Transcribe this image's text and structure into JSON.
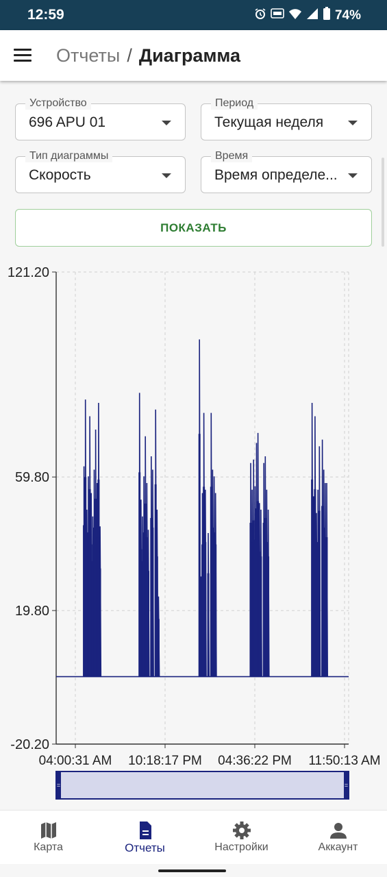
{
  "status_bar": {
    "time": "12:59",
    "battery": "74%",
    "icons": [
      "alarm-icon",
      "auto-icon",
      "wifi-icon",
      "signal-icon",
      "battery-icon"
    ]
  },
  "appbar": {
    "crumb_parent": "Отчеты",
    "crumb_separator": "/",
    "crumb_current": "Диаграмма"
  },
  "form": {
    "device_label": "Устройство",
    "device_value": "696 APU 01",
    "period_label": "Период",
    "period_value": "Текущая неделя",
    "chart_type_label": "Тип диаграммы",
    "chart_type_value": "Скорость",
    "time_label": "Время",
    "time_value": "Время определе...",
    "show_button": "ПОКАЗАТЬ"
  },
  "chart_data": {
    "type": "line",
    "title": "",
    "xlabel": "",
    "ylabel": "",
    "ylim": [
      -20.2,
      121.2
    ],
    "y_ticks": [
      "121.20",
      "59.80",
      "19.80",
      "-20.20"
    ],
    "x_ticks": [
      "04:00:31 AM",
      "10:18:17 PM",
      "04:36:22 PM",
      "11:50:13 AM"
    ],
    "grid": true,
    "color": "#1a237e",
    "baseline": 0,
    "spikes": [
      [
        0.095,
        63
      ],
      [
        0.1,
        83
      ],
      [
        0.105,
        50
      ],
      [
        0.11,
        60
      ],
      [
        0.115,
        78
      ],
      [
        0.12,
        55
      ],
      [
        0.125,
        48
      ],
      [
        0.13,
        62
      ],
      [
        0.135,
        74
      ],
      [
        0.14,
        58
      ],
      [
        0.145,
        82
      ],
      [
        0.15,
        45
      ],
      [
        0.285,
        85
      ],
      [
        0.29,
        53
      ],
      [
        0.295,
        48
      ],
      [
        0.3,
        60
      ],
      [
        0.305,
        72
      ],
      [
        0.31,
        58
      ],
      [
        0.315,
        44
      ],
      [
        0.325,
        66
      ],
      [
        0.33,
        62
      ],
      [
        0.34,
        80
      ],
      [
        0.345,
        50
      ],
      [
        0.35,
        24
      ],
      [
        0.49,
        101
      ],
      [
        0.495,
        30
      ],
      [
        0.5,
        55
      ],
      [
        0.505,
        79
      ],
      [
        0.51,
        56
      ],
      [
        0.52,
        43
      ],
      [
        0.53,
        79
      ],
      [
        0.535,
        62
      ],
      [
        0.54,
        60
      ],
      [
        0.545,
        55
      ],
      [
        0.665,
        64
      ],
      [
        0.67,
        56
      ],
      [
        0.675,
        65
      ],
      [
        0.68,
        57
      ],
      [
        0.685,
        70
      ],
      [
        0.69,
        73
      ],
      [
        0.695,
        52
      ],
      [
        0.7,
        50
      ],
      [
        0.71,
        64
      ],
      [
        0.715,
        66
      ],
      [
        0.72,
        56
      ],
      [
        0.725,
        50
      ],
      [
        0.875,
        82
      ],
      [
        0.88,
        54
      ],
      [
        0.885,
        78
      ],
      [
        0.89,
        49
      ],
      [
        0.895,
        56
      ],
      [
        0.9,
        69
      ],
      [
        0.91,
        71
      ],
      [
        0.915,
        62
      ],
      [
        0.92,
        58
      ],
      [
        0.925,
        58
      ]
    ]
  },
  "bottom_nav": [
    {
      "label": "Карта",
      "icon": "map-icon",
      "active": false
    },
    {
      "label": "Отчеты",
      "icon": "report-icon",
      "active": true
    },
    {
      "label": "Настройки",
      "icon": "gear-icon",
      "active": false
    },
    {
      "label": "Аккаунт",
      "icon": "account-icon",
      "active": false
    }
  ]
}
